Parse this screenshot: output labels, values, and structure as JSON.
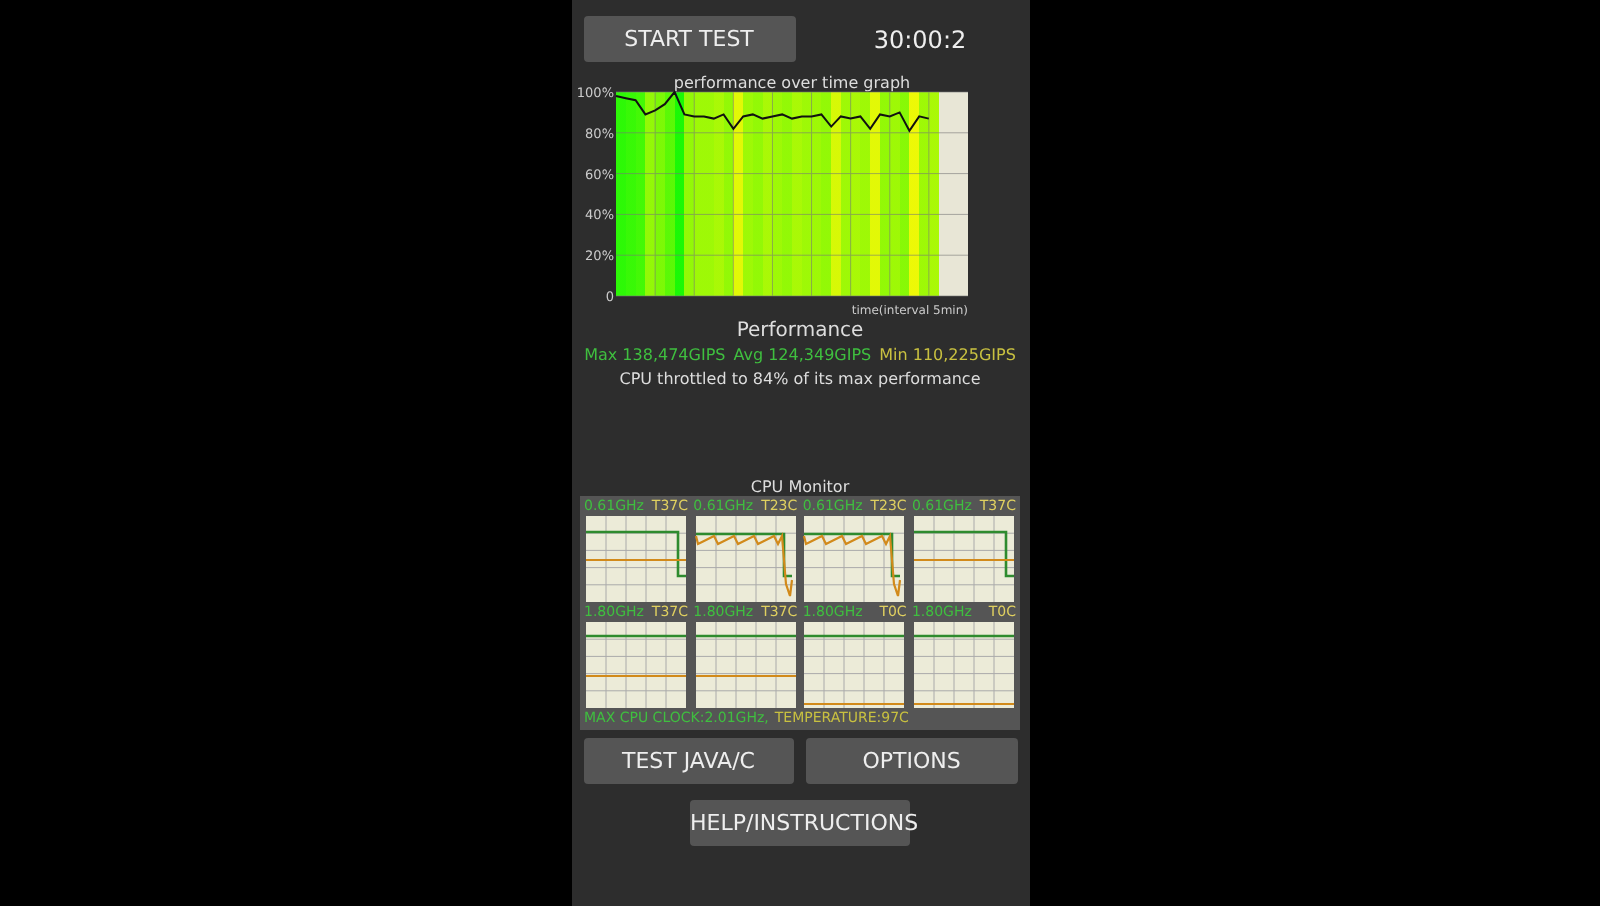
{
  "start_button": "START TEST",
  "timer": "30:00:2",
  "performance_graph": {
    "chart_data": {
      "type": "line",
      "title": "performance over time graph",
      "xlabel": "time(interval 5min)",
      "categories": [
        null,
        null,
        null,
        null,
        null,
        null,
        null,
        null,
        null,
        null,
        null,
        null,
        null,
        null,
        null,
        null,
        null,
        null,
        null,
        null,
        null,
        null,
        null,
        null,
        null,
        null,
        null,
        null,
        null,
        null,
        null,
        null,
        null
      ],
      "ylim": [
        0,
        100
      ],
      "grid": true,
      "yticks": [
        {
          "value": 0,
          "label": "0"
        },
        {
          "value": 20,
          "label": "20%"
        },
        {
          "value": 40,
          "label": "40%"
        },
        {
          "value": 60,
          "label": "60%"
        },
        {
          "value": 80,
          "label": "80%"
        },
        {
          "value": 100,
          "label": "100%"
        }
      ],
      "series": [
        {
          "color": "#111111",
          "values": [
            98,
            97,
            96,
            89,
            91,
            94,
            100,
            89,
            88,
            88,
            87,
            89,
            82,
            88,
            89,
            87,
            88,
            89,
            87,
            88,
            88,
            89,
            83,
            88,
            87,
            88,
            82,
            89,
            88,
            90,
            81,
            88,
            87
          ]
        }
      ]
    }
  },
  "performance": {
    "title": "Performance",
    "max": "Max 138,474GIPS",
    "avg": "Avg 124,349GIPS",
    "min": "Min 110,225GIPS",
    "throttle": "CPU throttled to 84% of its max performance"
  },
  "cpu_monitor": {
    "title": "CPU Monitor",
    "cores": [
      {
        "frequency": "0.61GHz",
        "temperature": "T37C",
        "kind": "drop"
      },
      {
        "frequency": "0.61GHz",
        "temperature": "T23C",
        "kind": "noisy"
      },
      {
        "frequency": "0.61GHz",
        "temperature": "T23C",
        "kind": "noisy"
      },
      {
        "frequency": "0.61GHz",
        "temperature": "T37C",
        "kind": "drop"
      },
      {
        "frequency": "1.80GHz",
        "temperature": "T37C",
        "kind": "flat"
      },
      {
        "frequency": "1.80GHz",
        "temperature": "T37C",
        "kind": "flat"
      },
      {
        "frequency": "1.80GHz",
        "temperature": "T0C",
        "kind": "cold"
      },
      {
        "frequency": "1.80GHz",
        "temperature": "T0C",
        "kind": "cold"
      }
    ],
    "max_clock": "MAX CPU CLOCK:2.01GHz,",
    "temperature": "TEMPERATURE:97C"
  },
  "buttons": [
    "TEST JAVA/C",
    "OPTIONS"
  ],
  "help_button": "HELP/INSTRUCTIONS"
}
